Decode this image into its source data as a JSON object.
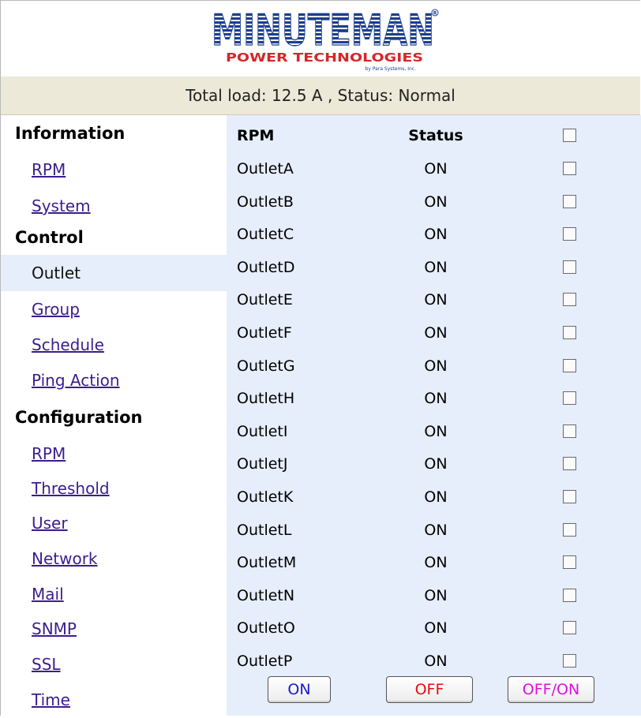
{
  "brand": {
    "name": "MINUTEMAN",
    "tagline": "POWER TECHNOLOGIES",
    "subline": "by Para Systems, Inc.",
    "colors": {
      "navy": "#1b3f8f",
      "red": "#d6262a"
    }
  },
  "status_bar": {
    "text": "Total load: 12.5 A , Status: Normal"
  },
  "sidebar": {
    "sections": [
      {
        "title": "Information",
        "items": [
          {
            "label": "RPM"
          },
          {
            "label": "System"
          }
        ]
      },
      {
        "title": "Control",
        "items": [
          {
            "label": "Outlet",
            "active": true
          },
          {
            "label": "Group"
          },
          {
            "label": "Schedule"
          },
          {
            "label": "Ping Action"
          }
        ]
      },
      {
        "title": "Configuration",
        "items": [
          {
            "label": "RPM"
          },
          {
            "label": "Threshold"
          },
          {
            "label": "User"
          },
          {
            "label": "Network"
          },
          {
            "label": "Mail"
          },
          {
            "label": "SNMP"
          },
          {
            "label": "SSL"
          },
          {
            "label": "Time"
          }
        ]
      }
    ]
  },
  "table": {
    "headers": {
      "name": "RPM",
      "status": "Status"
    },
    "rows": [
      {
        "name": "OutletA",
        "status": "ON"
      },
      {
        "name": "OutletB",
        "status": "ON"
      },
      {
        "name": "OutletC",
        "status": "ON"
      },
      {
        "name": "OutletD",
        "status": "ON"
      },
      {
        "name": "OutletE",
        "status": "ON"
      },
      {
        "name": "OutletF",
        "status": "ON"
      },
      {
        "name": "OutletG",
        "status": "ON"
      },
      {
        "name": "OutletH",
        "status": "ON"
      },
      {
        "name": "OutletI",
        "status": "ON"
      },
      {
        "name": "OutletJ",
        "status": "ON"
      },
      {
        "name": "OutletK",
        "status": "ON"
      },
      {
        "name": "OutletL",
        "status": "ON"
      },
      {
        "name": "OutletM",
        "status": "ON"
      },
      {
        "name": "OutletN",
        "status": "ON"
      },
      {
        "name": "OutletO",
        "status": "ON"
      },
      {
        "name": "OutletP",
        "status": "ON"
      }
    ]
  },
  "buttons": {
    "on": {
      "label": "ON",
      "color": "#1a1acc"
    },
    "off": {
      "label": "OFF",
      "color": "#e01010"
    },
    "offon": {
      "label": "OFF/ON",
      "color": "#e010e0"
    }
  }
}
